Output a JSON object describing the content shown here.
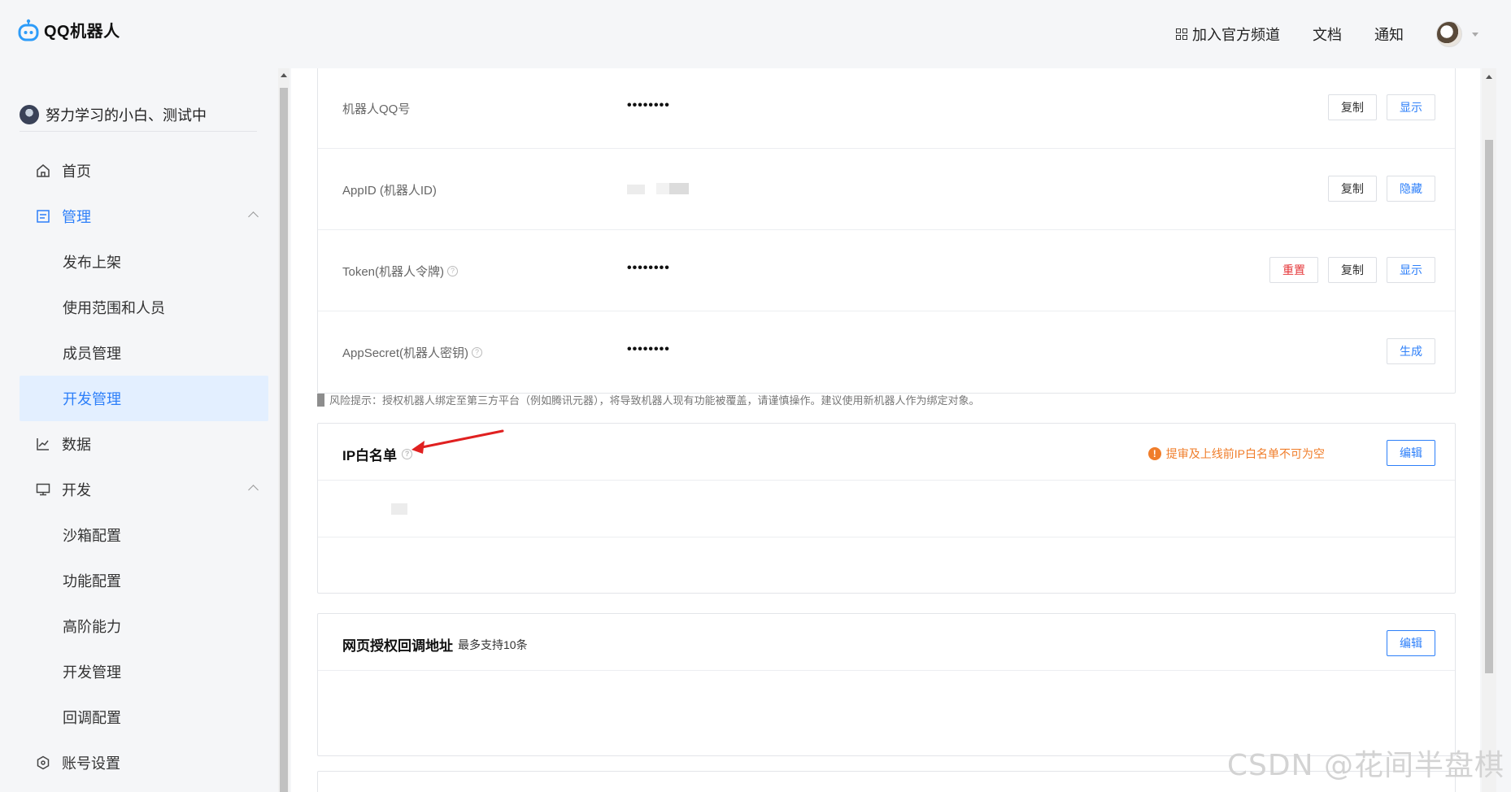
{
  "header": {
    "logo_text": "QQ机器人",
    "nav": {
      "join_channel": "加入官方频道",
      "docs": "文档",
      "notify": "通知"
    }
  },
  "sidebar": {
    "account_name": "努力学习的小白、测试中",
    "items": [
      {
        "label": "首页",
        "icon": "home-icon"
      },
      {
        "label": "管理",
        "icon": "manage-icon"
      },
      {
        "label": "发布上架"
      },
      {
        "label": "使用范围和人员"
      },
      {
        "label": "成员管理"
      },
      {
        "label": "开发管理"
      },
      {
        "label": "数据",
        "icon": "chart-icon"
      },
      {
        "label": "开发",
        "icon": "monitor-icon"
      },
      {
        "label": "沙箱配置"
      },
      {
        "label": "功能配置"
      },
      {
        "label": "高阶能力"
      },
      {
        "label": "开发管理"
      },
      {
        "label": "回调配置"
      },
      {
        "label": "账号设置",
        "icon": "settings-hex-icon"
      }
    ]
  },
  "credentials": {
    "rows": [
      {
        "label": "机器人QQ号",
        "value": "••••••••",
        "buttons": [
          "复制",
          "显示"
        ]
      },
      {
        "label": "AppID (机器人ID)",
        "value": "",
        "buttons": [
          "复制",
          "隐藏"
        ]
      },
      {
        "label": "Token(机器人令牌)",
        "value": "••••••••",
        "buttons": [
          "重置",
          "复制",
          "显示"
        ]
      },
      {
        "label": "AppSecret(机器人密钥)",
        "value": "••••••••",
        "buttons": [
          "生成"
        ]
      }
    ],
    "risk_tip": "风险提示：授权机器人绑定至第三方平台（例如腾讯元器），将导致机器人现有功能被覆盖，请谨慎操作。建议使用新机器人作为绑定对象。"
  },
  "ip_whitelist": {
    "title": "IP白名单",
    "warning": "提审及上线前IP白名单不可为空",
    "edit_label": "编辑"
  },
  "oauth_callback": {
    "title": "网页授权回调地址",
    "note": "最多支持10条",
    "edit_label": "编辑"
  },
  "watermark": "CSDN @花间半盘棋",
  "colors": {
    "accent": "#2d7ff9",
    "danger": "#e5383b",
    "warning": "#f07d2a",
    "active_bg": "#e3efff"
  }
}
